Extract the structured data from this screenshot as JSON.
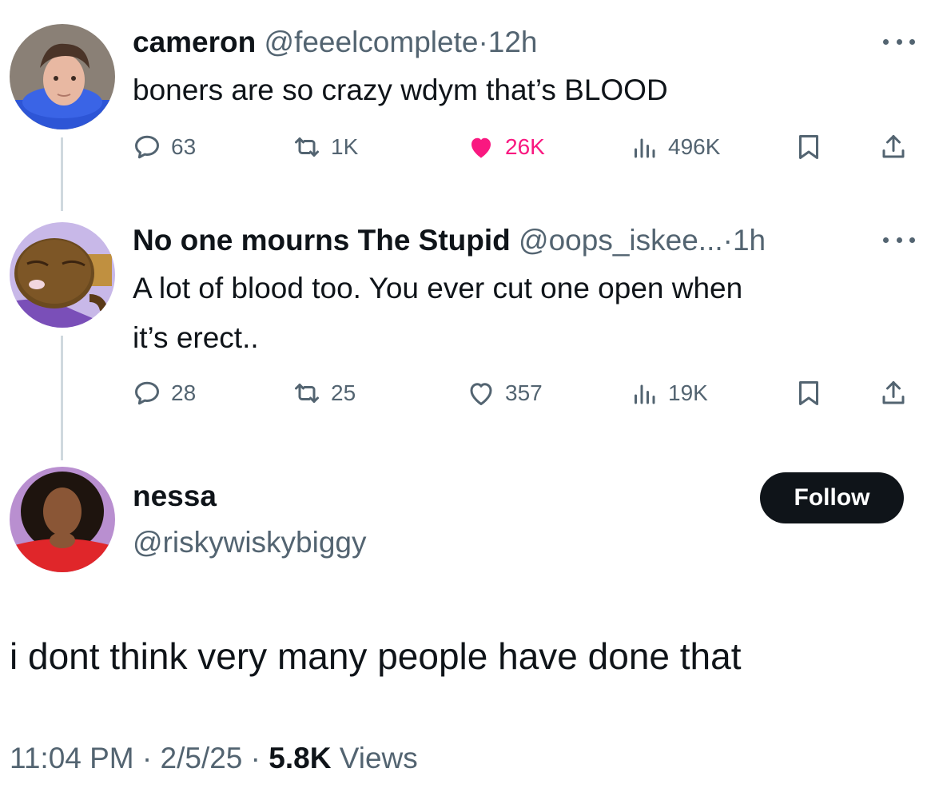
{
  "tweets": [
    {
      "name": "cameron",
      "handle": "@feeelcomplete",
      "time": "12h",
      "text_lines": [
        "boners are so crazy wdym that’s BLOOD"
      ],
      "replies": "63",
      "reposts": "1K",
      "likes": "26K",
      "views": "496K",
      "liked": true
    },
    {
      "name": "No one mourns The Stupid",
      "handle": "@oops_iskee...",
      "time": "1h",
      "text_lines": [
        "A lot of blood too. You ever cut one open when",
        "it’s erect.."
      ],
      "replies": "28",
      "reposts": "25",
      "likes": "357",
      "views": "19K",
      "liked": false
    }
  ],
  "reply": {
    "name": "nessa",
    "handle": "@riskywiskybiggy",
    "follow_label": "Follow",
    "text": "i dont think very many people have done that",
    "time": "11:04 PM",
    "date": "2/5/25",
    "views_count": "5.8K",
    "views_label": "Views"
  },
  "separator": "·",
  "colors": {
    "text": "#0f1419",
    "secondary": "#536471",
    "like": "#f91880",
    "thread_line": "#cfd9de",
    "follow_bg": "#0f1419"
  },
  "icons": [
    "reply-icon",
    "repost-icon",
    "like-icon",
    "views-icon",
    "bookmark-icon",
    "share-icon",
    "more-icon"
  ]
}
